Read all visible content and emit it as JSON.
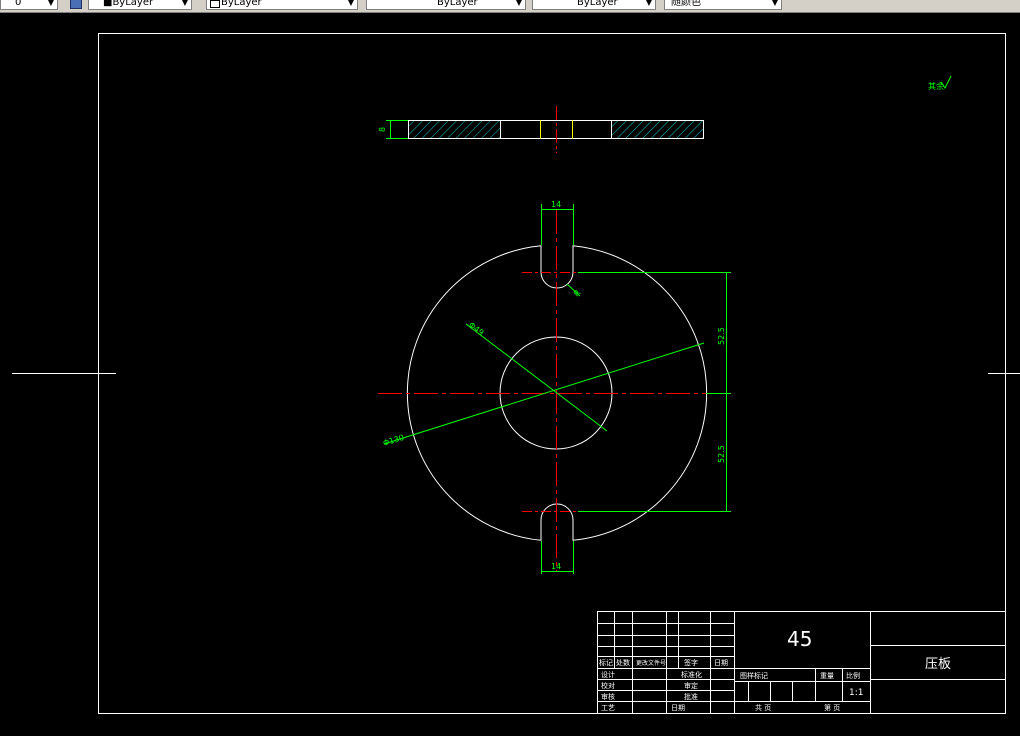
{
  "toolbar": {
    "color_control": "■ByLayer",
    "layer_filter": "0",
    "linetype_control": "ByLayer",
    "lineweight_control": "ByLayer",
    "plotstyle_control": "ByLayer",
    "style_control": "随颜色"
  },
  "drawing": {
    "roughness_mark": "其余",
    "dimensions": {
      "thickness": "8",
      "slot_width_top": "14",
      "slot_width_bottom": "14",
      "slot_radius": "R",
      "bore_diameter": "Φ49",
      "outer_diameter": "Φ130",
      "distance_top": "52.5",
      "distance_bottom": "52.5"
    }
  },
  "title_block": {
    "material": "45",
    "part_name": "压板",
    "scale": "1:1",
    "headers": {
      "mark": "标记",
      "count": "处数",
      "change_doc": "更改文件号",
      "signature": "签字",
      "date": "日期",
      "design": "设计",
      "standardize": "标准化",
      "check": "校对",
      "review": "审定",
      "audit": "审核",
      "approve": "批准",
      "process": "工艺",
      "date2": "日期",
      "stage_mark": "图样标记",
      "weight": "重量",
      "scale_label": "比例",
      "sheets_total": "共 页",
      "sheet_no": "第 页"
    }
  }
}
